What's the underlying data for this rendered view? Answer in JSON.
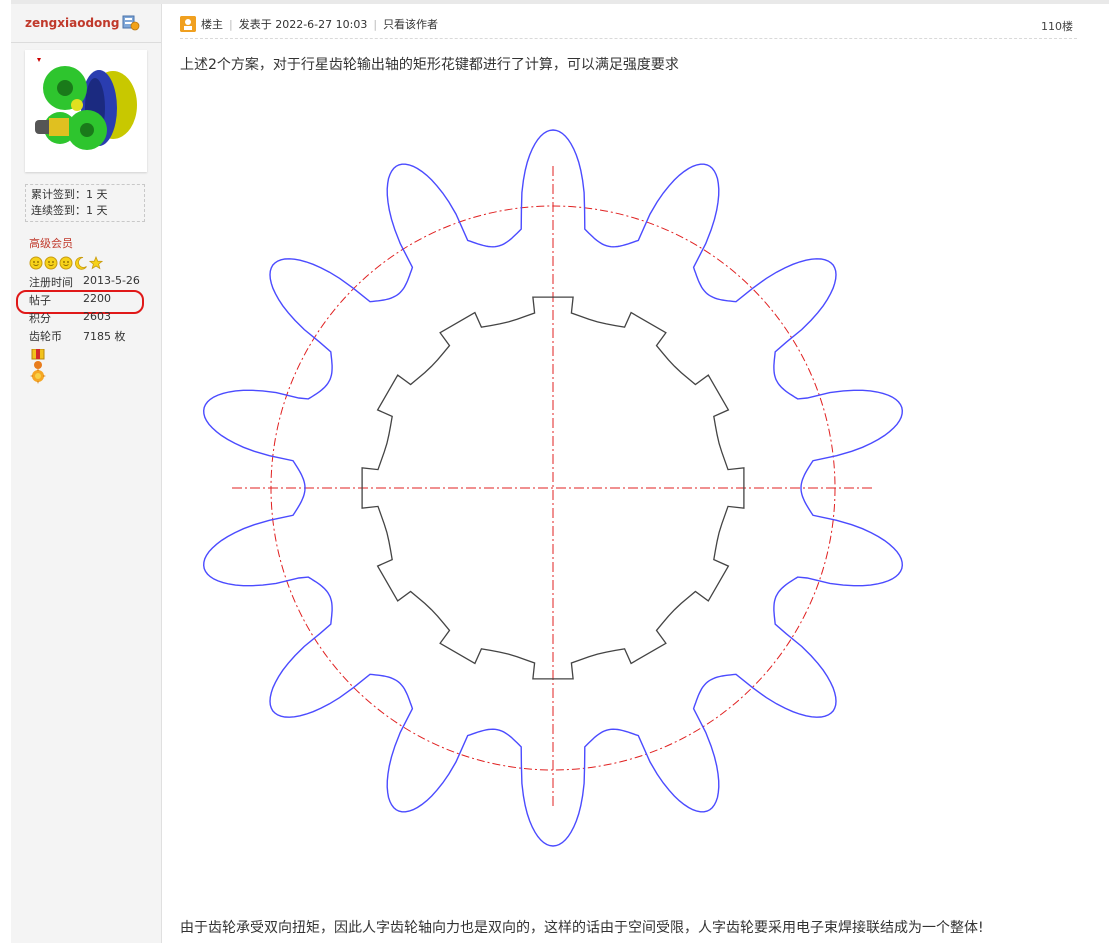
{
  "user": {
    "name": "zengxiaodong",
    "sign_total": "累计签到：1 天",
    "sign_streak": "连续签到：1 天",
    "member_level": "高级会员",
    "stats": [
      {
        "label": "注册时间",
        "value": "2013-5-26"
      },
      {
        "label": "帖子",
        "value": "2200"
      },
      {
        "label": "积分",
        "value": "2603"
      },
      {
        "label": "齿轮币",
        "value": "7185 枚"
      }
    ]
  },
  "post": {
    "role": "楼主",
    "posted": "发表于 2022-6-27 10:03",
    "only_author": "只看该作者",
    "floor": "110楼",
    "intro": "上述2个方案，对于行星齿轮输出轴的矩形花键都进行了计算，可以满足强度要求",
    "outro": "由于齿轮承受双向扭矩，因此人字齿轮轴向力也是双向的，这样的话由于空间受限，人字齿轮要采用电子束焊接联结成为一个整体!"
  },
  "drawing": {
    "gear_teeth": 14,
    "spline_teeth": 12,
    "gear_color": "#4b4bff",
    "pitch_circle_color": "#e02020",
    "spline_color": "#444444",
    "centerline_color": "#e02020"
  },
  "colors": {
    "accent_red": "#c0392b",
    "highlight": "#e01818"
  }
}
